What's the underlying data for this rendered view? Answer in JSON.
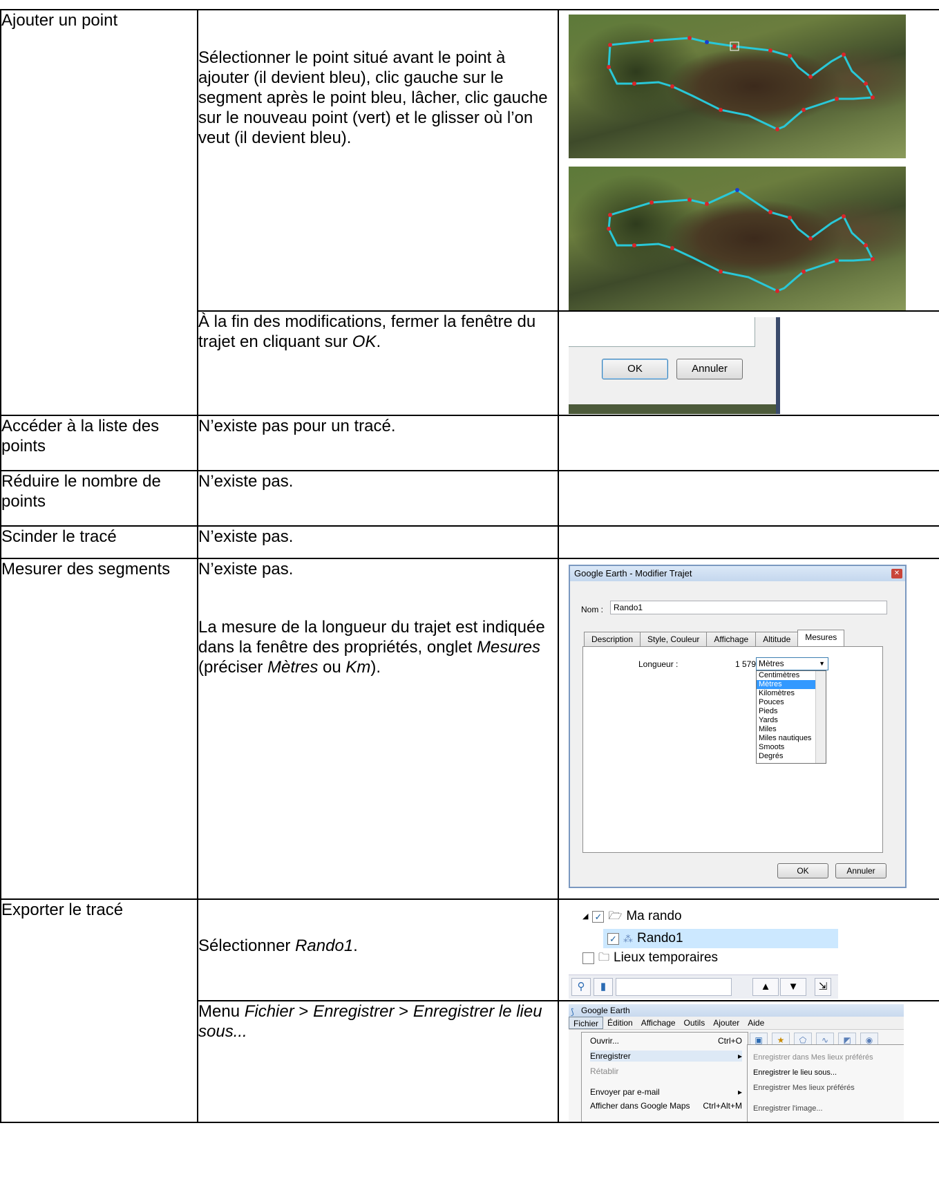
{
  "rows": [
    {
      "action": "Ajouter un point",
      "steps": [
        {
          "text": "Sélectionner le point situé avant le point à ajouter (il devient bleu), clic gauche sur le segment après le point bleu, lâcher, clic gauche sur le nouveau point (vert) et le glisser où l’on veut (il devient bleu)."
        },
        {
          "text_before": "À la fin des modifications, fermer la fenêtre du trajet en cliquant sur ",
          "text_em": "OK",
          "text_after": "."
        }
      ]
    },
    {
      "action": "Accéder à la liste des points",
      "text": "N’existe pas pour un tracé."
    },
    {
      "action": "Réduire le nombre de points",
      "text": "N’existe pas."
    },
    {
      "action": "Scinder le tracé",
      "text": "N’existe pas."
    },
    {
      "action": "Mesurer des segments",
      "text": "N’existe pas.",
      "text2_a": "La mesure de la longueur du trajet est indiquée dans la fenêtre des propriétés, onglet ",
      "text2_em1": "Mesures",
      "text2_b": " (préciser ",
      "text2_em2": "Mètres",
      "text2_c": " ou ",
      "text2_em3": "Km",
      "text2_d": ")."
    },
    {
      "action": "Exporter le tracé",
      "step1_a": "Sélectionner ",
      "step1_em": "Rando1",
      "step1_b": ".",
      "step2_a": "Menu ",
      "step2_em1": "Fichier",
      "step2_b": " > ",
      "step2_em2": "Enregistrer",
      "step2_c": " > ",
      "step2_em3": "Enregistrer le lieu sous..."
    }
  ],
  "ok_dialog": {
    "ok": "OK",
    "cancel": "Annuler"
  },
  "trajet_dialog": {
    "title": "Google Earth - Modifier Trajet",
    "name_label": "Nom :",
    "name_value": "Rando1",
    "tabs": [
      "Description",
      "Style, Couleur",
      "Affichage",
      "Altitude",
      "Mesures"
    ],
    "length_label": "Longueur :",
    "length_value": "1 579",
    "unit_selected": "Mètres",
    "units": [
      "Centimètres",
      "Mètres",
      "Kilomètres",
      "Pouces",
      "Pieds",
      "Yards",
      "Miles",
      "Miles nautiques",
      "Smoots",
      "Degrés"
    ],
    "ok": "OK",
    "cancel": "Annuler"
  },
  "tree": {
    "folder": "Ma rando",
    "item": "Rando1",
    "temp": "Lieux temporaires"
  },
  "menu": {
    "title": "Google Earth",
    "bar": [
      "Fichier",
      "Édition",
      "Affichage",
      "Outils",
      "Ajouter",
      "Aide"
    ],
    "items": [
      {
        "label": "Ouvrir...",
        "shortcut": "Ctrl+O"
      },
      {
        "label": "Enregistrer",
        "shortcut": "▸"
      },
      {
        "label": "Rétablir",
        "shortcut": ""
      },
      {
        "label": "Envoyer par e-mail",
        "shortcut": "▸"
      },
      {
        "label": "Afficher dans Google Maps",
        "shortcut": "Ctrl+Alt+M"
      }
    ],
    "submenu": [
      "Enregistrer dans Mes lieux préférés",
      "Enregistrer le lieu sous...",
      "Enregistrer Mes lieux préférés",
      "Enregistrer l'image..."
    ]
  },
  "colors": {
    "track": "#29c8d8",
    "node": "#d9252a",
    "selected_node": "#1a3fd0"
  }
}
